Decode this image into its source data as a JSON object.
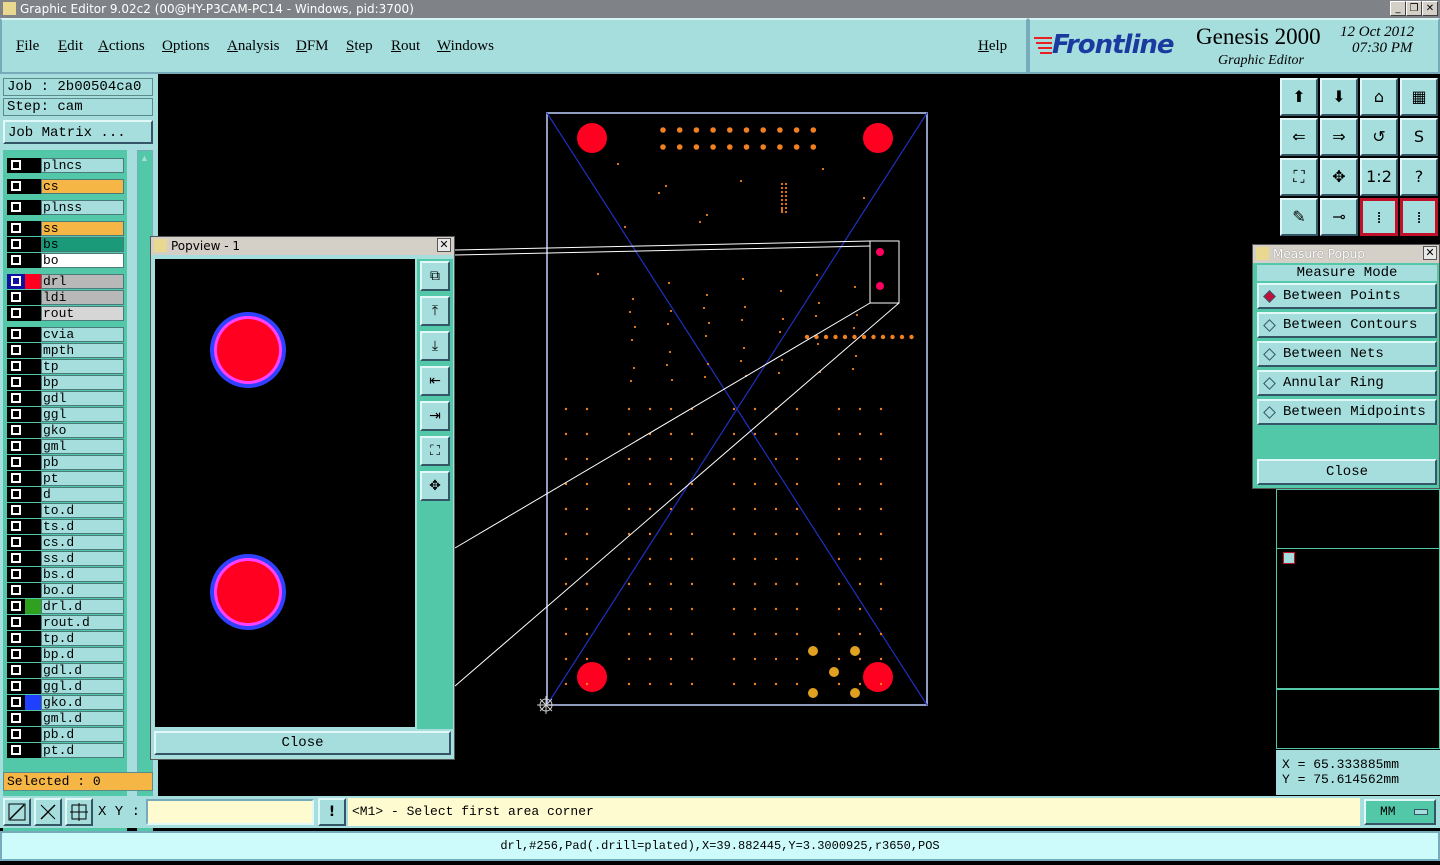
{
  "titlebar": {
    "title": "Graphic Editor 9.02c2 (00@HY-P3CAM-PC14 - Windows, pid:3700)"
  },
  "menu": {
    "items": [
      "File",
      "Edit",
      "Actions",
      "Options",
      "Analysis",
      "DFM",
      "Step",
      "Rout",
      "Windows"
    ],
    "help": "Help"
  },
  "brand": {
    "logo": "Frontline",
    "product": "Genesis 2000",
    "subtitle": "Graphic Editor",
    "date": "12 Oct 2012",
    "time": "07:30 PM"
  },
  "job": {
    "job": "Job : 2b00504ca0",
    "step": "Step: cam",
    "matrix": "Job Matrix ..."
  },
  "layers": [
    {
      "name": "plncs",
      "bg": "#a6dede"
    },
    {
      "name": "cs",
      "bg": "#f6b646"
    },
    {
      "name": "plnss",
      "bg": "#a6dede"
    },
    {
      "name": "ss",
      "bg": "#f6b646"
    },
    {
      "name": "bs",
      "bg": "#1a9a78"
    },
    {
      "name": "bo",
      "bg": "#ffffff"
    },
    {
      "name": "drl",
      "bg": "#b8b8b8"
    },
    {
      "name": "ldi",
      "bg": "#b8b8b8"
    },
    {
      "name": "rout",
      "bg": "#d6d6d6"
    },
    {
      "name": "cvia",
      "bg": "#a6dede"
    },
    {
      "name": "mpth",
      "bg": "#a6dede"
    },
    {
      "name": "tp",
      "bg": "#a6dede"
    },
    {
      "name": "bp",
      "bg": "#a6dede"
    },
    {
      "name": "gdl",
      "bg": "#a6dede"
    },
    {
      "name": "ggl",
      "bg": "#a6dede"
    },
    {
      "name": "gko",
      "bg": "#a6dede"
    },
    {
      "name": "gml",
      "bg": "#a6dede"
    },
    {
      "name": "pb",
      "bg": "#a6dede"
    },
    {
      "name": "pt",
      "bg": "#a6dede"
    },
    {
      "name": "d",
      "bg": "#a6dede"
    },
    {
      "name": "to.d",
      "bg": "#a6dede"
    },
    {
      "name": "ts.d",
      "bg": "#a6dede"
    },
    {
      "name": "cs.d",
      "bg": "#a6dede"
    },
    {
      "name": "ss.d",
      "bg": "#a6dede"
    },
    {
      "name": "bs.d",
      "bg": "#a6dede"
    },
    {
      "name": "bo.d",
      "bg": "#a6dede"
    },
    {
      "name": "drl.d",
      "bg": "#a6dede"
    },
    {
      "name": "rout.d",
      "bg": "#a6dede"
    },
    {
      "name": "tp.d",
      "bg": "#a6dede"
    },
    {
      "name": "bp.d",
      "bg": "#a6dede"
    },
    {
      "name": "gdl.d",
      "bg": "#a6dede"
    },
    {
      "name": "ggl.d",
      "bg": "#a6dede"
    },
    {
      "name": "gko.d",
      "bg": "#a6dede"
    },
    {
      "name": "gml.d",
      "bg": "#a6dede"
    },
    {
      "name": "pb.d",
      "bg": "#a6dede"
    },
    {
      "name": "pt.d",
      "bg": "#a6dede"
    }
  ],
  "selected": "Selected : 0",
  "popview": {
    "title": "Popview - 1",
    "close": "Close"
  },
  "measure": {
    "title": "Measure Popup",
    "mode": "Measure Mode",
    "options": [
      "Between Points",
      "Between Contours",
      "Between Nets",
      "Annular Ring",
      "Between Midpoints"
    ],
    "close": "Close"
  },
  "coords": {
    "x": "X = 65.333885mm",
    "y": "Y = 75.614562mm"
  },
  "bottom": {
    "xy_label": "X Y :",
    "prompt": "<M1> - Select first area corner",
    "units": "MM",
    "status": "drl,#256,Pad(.drill=plated),X=39.882445,Y=3.3000925,r3650,POS"
  },
  "colors": {
    "panel": "#a6dede",
    "accent": "#52c8a8",
    "pad": "#ff0020",
    "trace": "#f08020"
  }
}
